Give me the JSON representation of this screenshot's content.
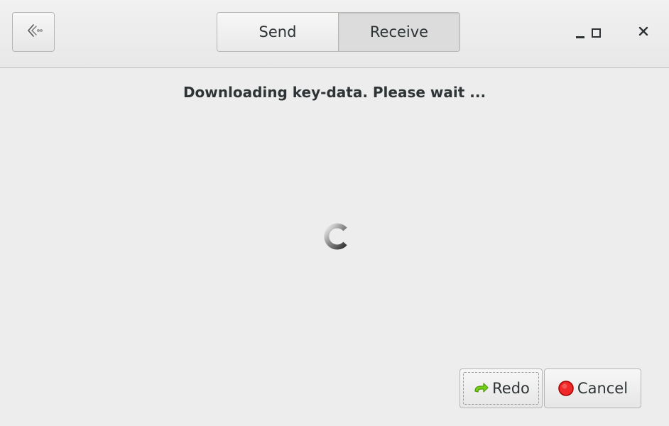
{
  "header": {
    "back_icon": "back-arrow-icon",
    "tabs": [
      {
        "label": "Send",
        "active": false
      },
      {
        "label": "Receive",
        "active": true
      }
    ],
    "window_controls": [
      "minimize-icon",
      "maximize-icon",
      "close-icon"
    ]
  },
  "main": {
    "status_text": "Downloading key-data. Please wait ...",
    "spinner_icon": "loading-spinner-icon"
  },
  "actions": {
    "redo_label": "Redo",
    "redo_icon": "redo-arrow-icon",
    "cancel_label": "Cancel",
    "cancel_icon": "stop-icon"
  },
  "colors": {
    "background": "#ededed",
    "text": "#2e3436",
    "redo_icon": "#4e9a06",
    "stop_icon": "#cc0000"
  }
}
